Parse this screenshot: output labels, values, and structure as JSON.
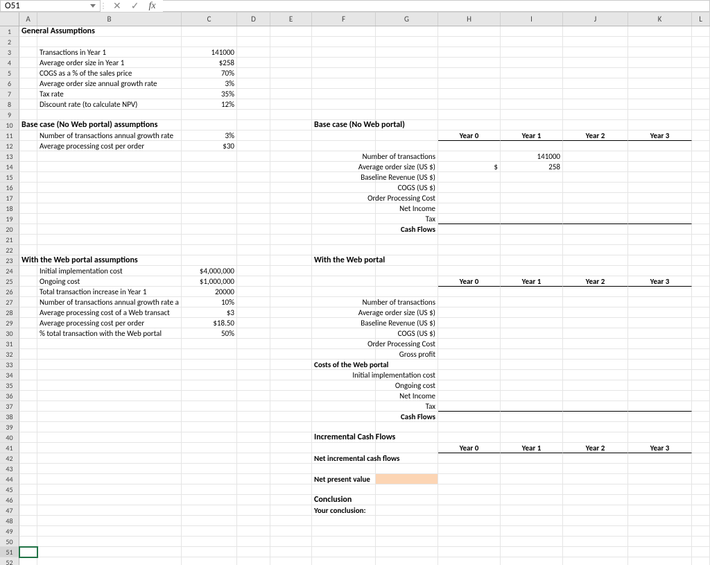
{
  "cell_ref": "O51",
  "formula_value": "",
  "columns": [
    "A",
    "B",
    "C",
    "D",
    "E",
    "F",
    "G",
    "H",
    "I",
    "J",
    "K",
    "L"
  ],
  "col_classes": [
    "cA",
    "cB",
    "cC",
    "cD",
    "cE",
    "cF",
    "cG",
    "cH",
    "cI",
    "cJ",
    "cK",
    "cL"
  ],
  "row_count": 52,
  "selected_row": 51,
  "icons": {
    "cancel": "✕",
    "accept": "✓",
    "fx": "fx"
  },
  "bold_cells": {
    "A1": "General Assumptions",
    "A10": "Base case (No Web portal) assumptions",
    "F10": "Base case (No Web portal)",
    "A23": "With the Web portal assumptions",
    "F23": "With the Web portal",
    "F40": "Incremental Cash Flows",
    "F46": "Conclusion"
  },
  "bold_small": {
    "G20": "Cash Flows",
    "F33": "Costs of the Web portal",
    "G38": "Cash Flows",
    "F42": "Net incremental cash flows",
    "F44": "Net present value",
    "F47": "Your conclusion:"
  },
  "year_headers": {
    "row11": {
      "H": "Year 0",
      "I": "Year 1",
      "J": "Year 2",
      "K": "Year 3"
    },
    "row25": {
      "H": "Year 0",
      "I": "Year 1",
      "J": "Year 2",
      "K": "Year 3"
    },
    "row41": {
      "H": "Year 0",
      "I": "Year 1",
      "J": "Year 2",
      "K": "Year 3"
    }
  },
  "left_labels": {
    "B3": "Transactions in Year 1",
    "B4": "Average order size in Year 1",
    "B5": "COGS as a % of the sales price",
    "B6": "Average order size annual growth rate",
    "B7": "Tax rate",
    "B8": "Discount rate (to calculate NPV)",
    "B11": "Number of transactions annual growth rate",
    "B12": "Average processing cost per order",
    "B24": "Initial implementation cost",
    "B25": "Ongoing cost",
    "B26": "Total transaction increase in Year 1",
    "B27": "Number of transactions annual growth rate a",
    "B28": "Average processing cost of a Web transact",
    "B29": "Average processing cost per order",
    "B30": "% total transaction with the Web portal"
  },
  "c_values": {
    "C3": "141000",
    "C4": "$258",
    "C5": "70%",
    "C6": "3%",
    "C7": "35%",
    "C8": "12%",
    "C11": "3%",
    "C12": "$30",
    "C24": "$4,000,000",
    "C25": "$1,000,000",
    "C26": "20000",
    "C27": "10%",
    "C28": "$3",
    "C29": "$18.50",
    "C30": "50%"
  },
  "g_labels": {
    "G13": "Number of transactions",
    "G14": "Average order size (US $)",
    "G15": "Baseline Revenue (US $)",
    "G16": "COGS (US $)",
    "G17": "Order Processing Cost",
    "G18": "Net Income",
    "G19": "Tax",
    "G27": "Number of transactions",
    "G28": "Average order size (US $)",
    "G29": "Baseline Revenue (US $)",
    "G30": "COGS (US $)",
    "G31": "Order Processing Cost",
    "G32": "Gross profit",
    "G34": "Initial implementation cost",
    "G35": "Ongoing cost",
    "G36": "Net Income",
    "G37": "Tax"
  },
  "data_vals": {
    "I13": "141000",
    "H14": "$",
    "I14": "258"
  },
  "chart_data": null
}
